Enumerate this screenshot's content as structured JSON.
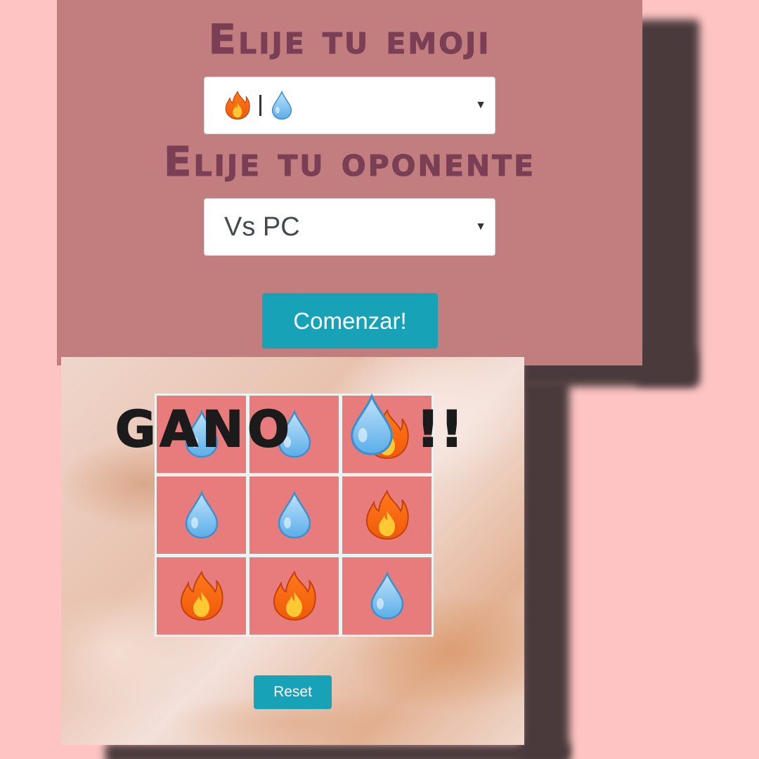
{
  "settings": {
    "emoji_heading": "Elije tu emoji",
    "emoji_select": {
      "selected_icons": [
        "fire-icon",
        "droplet-icon"
      ],
      "separator": "|"
    },
    "opponent_heading": "Elije tu oponente",
    "opponent_select": {
      "selected": "Vs PC"
    },
    "start_button": "Comenzar!"
  },
  "game": {
    "winner_text": "GANO",
    "winner_icon": "droplet-icon",
    "winner_suffix": "!!",
    "board": [
      "droplet",
      "droplet",
      "fire",
      "droplet",
      "droplet",
      "fire",
      "fire",
      "fire",
      "droplet"
    ],
    "reset_button": "Reset"
  },
  "colors": {
    "page_background": "#fec4c4",
    "panel_background": "#c27e7e",
    "heading_color": "#7a3f54",
    "button_color": "#17a2b8",
    "cell_color": "#e87c7c"
  }
}
